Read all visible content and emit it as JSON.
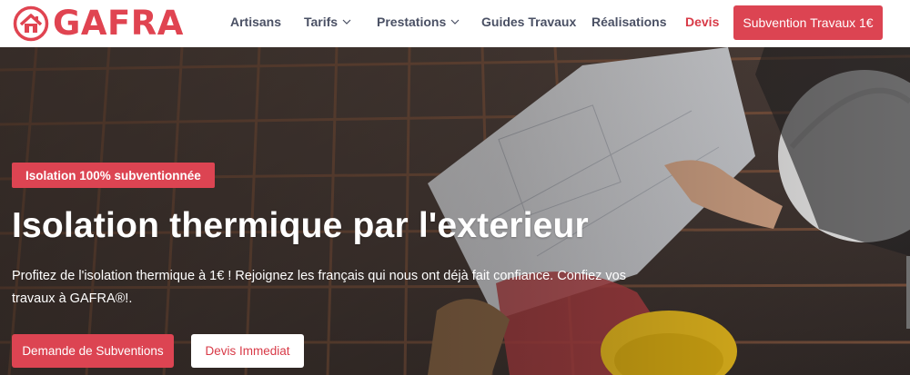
{
  "brand": {
    "name": "GAFRA",
    "color": "#e04451",
    "logo_icon": "house-icon"
  },
  "nav": {
    "items": [
      {
        "label": "Artisans",
        "dropdown": false
      },
      {
        "label": "Tarifs",
        "dropdown": true
      },
      {
        "label": "Prestations",
        "dropdown": true
      },
      {
        "label": "Guides Travaux",
        "dropdown": false
      },
      {
        "label": "Réalisations",
        "dropdown": false
      },
      {
        "label": "Devis",
        "dropdown": false,
        "highlight": true
      }
    ],
    "cta_label": "Subvention Travaux 1€"
  },
  "hero": {
    "badge": "Isolation 100% subventionnée",
    "title": "Isolation thermique par l'exterieur",
    "description": "Profitez de l'isolation thermique à 1€ ! Rejoignez les français qui nous ont déjà fait confiance. Confiez vos travaux à GAFRA®!.",
    "primary_button": "Demande de Subventions",
    "secondary_button": "Devis Immediat"
  },
  "colors": {
    "accent": "#dc4452",
    "nav_text": "#4a5064",
    "hero_text": "#ffffff"
  }
}
